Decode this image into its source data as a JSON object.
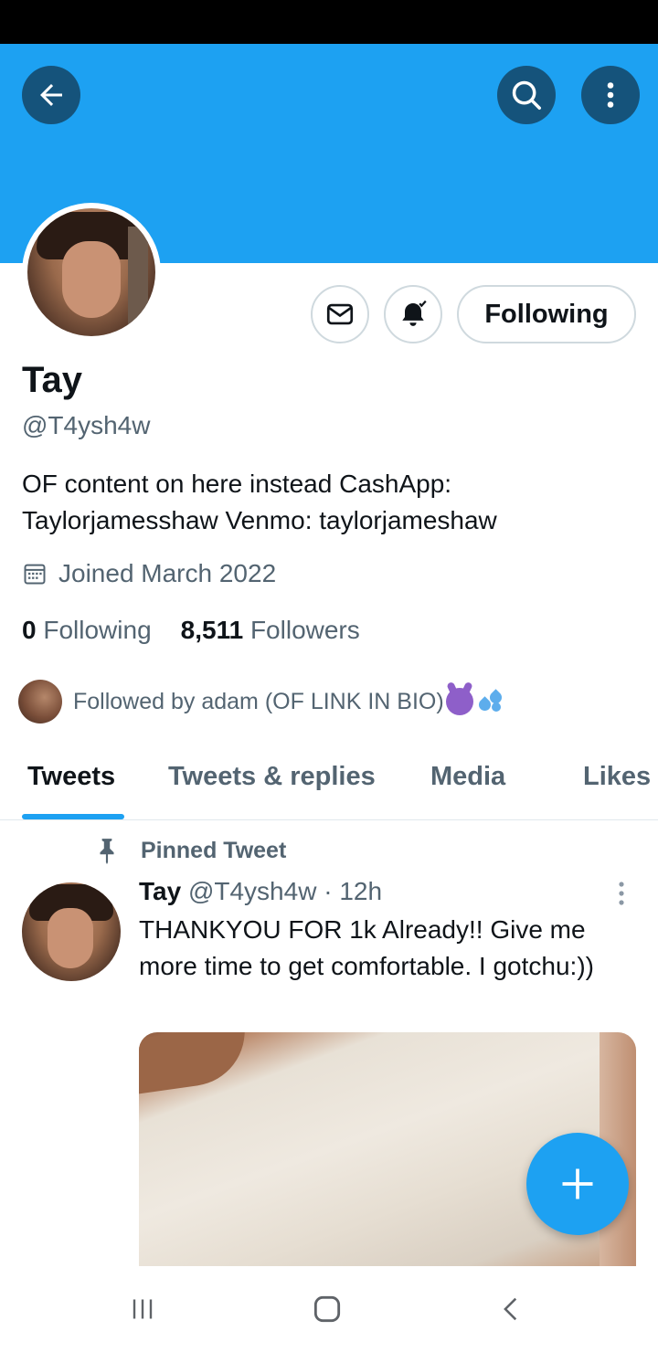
{
  "header": {
    "back_icon": "arrow-left-icon",
    "search_icon": "search-icon",
    "more_icon": "more-vertical-icon",
    "banner_color": "#1da1f2"
  },
  "profile": {
    "display_name": "Tay",
    "handle": "@T4ysh4w",
    "bio": "OF content on here instead  CashApp: Taylorjamesshaw Venmo: taylorjameshaw",
    "joined": "Joined March 2022",
    "following_count": "0",
    "following_label": "Following",
    "followers_count": "8,511",
    "followers_label": "Followers",
    "followed_by": "Followed by adam (OF LINK IN BIO)"
  },
  "actions": {
    "message_icon": "mail-icon",
    "notify_icon": "bell-subscribed-icon",
    "following_button": "Following"
  },
  "tabs": [
    {
      "label": "Tweets",
      "active": true
    },
    {
      "label": "Tweets & replies",
      "active": false
    },
    {
      "label": "Media",
      "active": false
    },
    {
      "label": "Likes",
      "active": false
    }
  ],
  "pinned_tweet": {
    "pinned_label": "Pinned Tweet",
    "author_name": "Tay",
    "author_handle": "@T4ysh4w",
    "separator": "·",
    "time": "12h",
    "text": "THANKYOU FOR 1k Already!! Give me more time to get comfortable. I gotchu:))"
  },
  "fab": {
    "icon": "plus-icon",
    "color": "#1da1f2"
  },
  "nav": {
    "recents_icon": "recents-icon",
    "home_icon": "home-icon",
    "back_icon": "nav-back-icon"
  }
}
